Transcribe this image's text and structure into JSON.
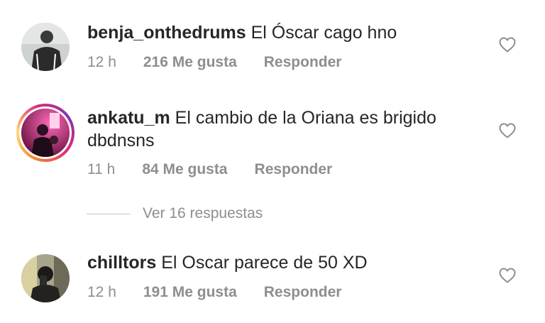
{
  "comments": [
    {
      "username": "benja_onthedrums",
      "text": " El Óscar cago hno",
      "time": "12 h",
      "likes": "216 Me gusta",
      "reply": "Responder"
    },
    {
      "username": "ankatu_m",
      "text": " El cambio de la Oriana es brigido dbdnsns",
      "time": "11 h",
      "likes": "84 Me gusta",
      "reply": "Responder",
      "view_replies": "Ver 16 respuestas"
    },
    {
      "username": "chilltors",
      "text": " El Oscar parece de 50 XD",
      "time": "12 h",
      "likes": "191 Me gusta",
      "reply": "Responder"
    }
  ],
  "icons": {
    "like": "heart-outline-icon"
  },
  "colors": {
    "primary_text": "#262626",
    "secondary_text": "#8e8e8e",
    "divider": "#c7c7c7"
  }
}
